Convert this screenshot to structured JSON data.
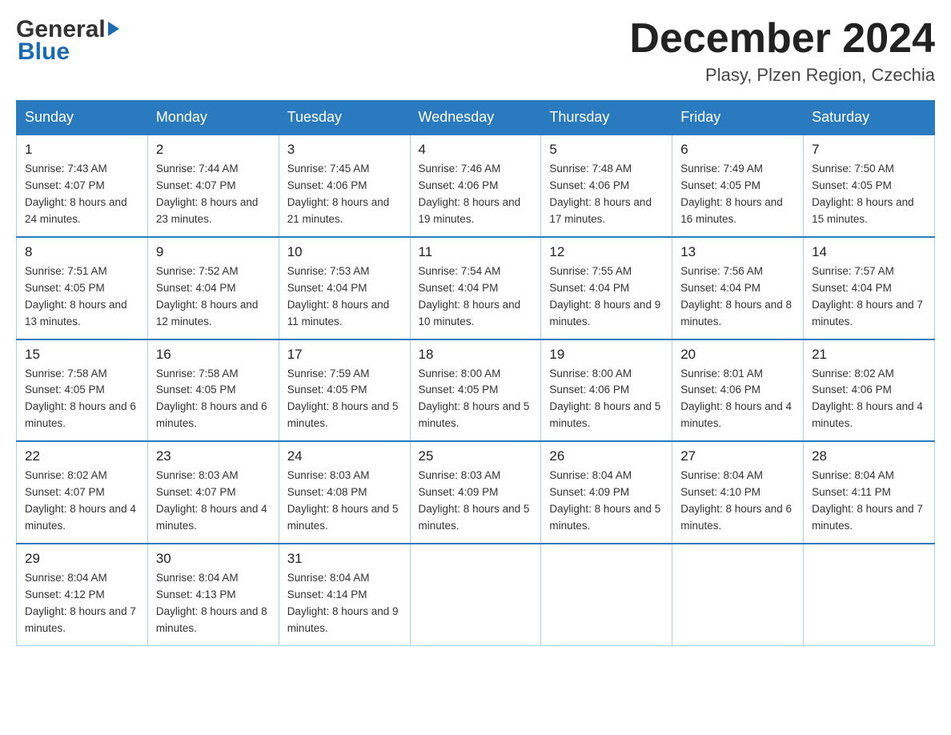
{
  "logo": {
    "line1": "General",
    "arrow": "▶",
    "line2": "Blue"
  },
  "title": "December 2024",
  "subtitle": "Plasy, Plzen Region, Czechia",
  "days_of_week": [
    "Sunday",
    "Monday",
    "Tuesday",
    "Wednesday",
    "Thursday",
    "Friday",
    "Saturday"
  ],
  "weeks": [
    [
      {
        "day": "1",
        "sunrise": "7:43 AM",
        "sunset": "4:07 PM",
        "daylight": "8 hours and 24 minutes."
      },
      {
        "day": "2",
        "sunrise": "7:44 AM",
        "sunset": "4:07 PM",
        "daylight": "8 hours and 23 minutes."
      },
      {
        "day": "3",
        "sunrise": "7:45 AM",
        "sunset": "4:06 PM",
        "daylight": "8 hours and 21 minutes."
      },
      {
        "day": "4",
        "sunrise": "7:46 AM",
        "sunset": "4:06 PM",
        "daylight": "8 hours and 19 minutes."
      },
      {
        "day": "5",
        "sunrise": "7:48 AM",
        "sunset": "4:06 PM",
        "daylight": "8 hours and 17 minutes."
      },
      {
        "day": "6",
        "sunrise": "7:49 AM",
        "sunset": "4:05 PM",
        "daylight": "8 hours and 16 minutes."
      },
      {
        "day": "7",
        "sunrise": "7:50 AM",
        "sunset": "4:05 PM",
        "daylight": "8 hours and 15 minutes."
      }
    ],
    [
      {
        "day": "8",
        "sunrise": "7:51 AM",
        "sunset": "4:05 PM",
        "daylight": "8 hours and 13 minutes."
      },
      {
        "day": "9",
        "sunrise": "7:52 AM",
        "sunset": "4:04 PM",
        "daylight": "8 hours and 12 minutes."
      },
      {
        "day": "10",
        "sunrise": "7:53 AM",
        "sunset": "4:04 PM",
        "daylight": "8 hours and 11 minutes."
      },
      {
        "day": "11",
        "sunrise": "7:54 AM",
        "sunset": "4:04 PM",
        "daylight": "8 hours and 10 minutes."
      },
      {
        "day": "12",
        "sunrise": "7:55 AM",
        "sunset": "4:04 PM",
        "daylight": "8 hours and 9 minutes."
      },
      {
        "day": "13",
        "sunrise": "7:56 AM",
        "sunset": "4:04 PM",
        "daylight": "8 hours and 8 minutes."
      },
      {
        "day": "14",
        "sunrise": "7:57 AM",
        "sunset": "4:04 PM",
        "daylight": "8 hours and 7 minutes."
      }
    ],
    [
      {
        "day": "15",
        "sunrise": "7:58 AM",
        "sunset": "4:05 PM",
        "daylight": "8 hours and 6 minutes."
      },
      {
        "day": "16",
        "sunrise": "7:58 AM",
        "sunset": "4:05 PM",
        "daylight": "8 hours and 6 minutes."
      },
      {
        "day": "17",
        "sunrise": "7:59 AM",
        "sunset": "4:05 PM",
        "daylight": "8 hours and 5 minutes."
      },
      {
        "day": "18",
        "sunrise": "8:00 AM",
        "sunset": "4:05 PM",
        "daylight": "8 hours and 5 minutes."
      },
      {
        "day": "19",
        "sunrise": "8:00 AM",
        "sunset": "4:06 PM",
        "daylight": "8 hours and 5 minutes."
      },
      {
        "day": "20",
        "sunrise": "8:01 AM",
        "sunset": "4:06 PM",
        "daylight": "8 hours and 4 minutes."
      },
      {
        "day": "21",
        "sunrise": "8:02 AM",
        "sunset": "4:06 PM",
        "daylight": "8 hours and 4 minutes."
      }
    ],
    [
      {
        "day": "22",
        "sunrise": "8:02 AM",
        "sunset": "4:07 PM",
        "daylight": "8 hours and 4 minutes."
      },
      {
        "day": "23",
        "sunrise": "8:03 AM",
        "sunset": "4:07 PM",
        "daylight": "8 hours and 4 minutes."
      },
      {
        "day": "24",
        "sunrise": "8:03 AM",
        "sunset": "4:08 PM",
        "daylight": "8 hours and 5 minutes."
      },
      {
        "day": "25",
        "sunrise": "8:03 AM",
        "sunset": "4:09 PM",
        "daylight": "8 hours and 5 minutes."
      },
      {
        "day": "26",
        "sunrise": "8:04 AM",
        "sunset": "4:09 PM",
        "daylight": "8 hours and 5 minutes."
      },
      {
        "day": "27",
        "sunrise": "8:04 AM",
        "sunset": "4:10 PM",
        "daylight": "8 hours and 6 minutes."
      },
      {
        "day": "28",
        "sunrise": "8:04 AM",
        "sunset": "4:11 PM",
        "daylight": "8 hours and 7 minutes."
      }
    ],
    [
      {
        "day": "29",
        "sunrise": "8:04 AM",
        "sunset": "4:12 PM",
        "daylight": "8 hours and 7 minutes."
      },
      {
        "day": "30",
        "sunrise": "8:04 AM",
        "sunset": "4:13 PM",
        "daylight": "8 hours and 8 minutes."
      },
      {
        "day": "31",
        "sunrise": "8:04 AM",
        "sunset": "4:14 PM",
        "daylight": "8 hours and 9 minutes."
      },
      null,
      null,
      null,
      null
    ]
  ]
}
